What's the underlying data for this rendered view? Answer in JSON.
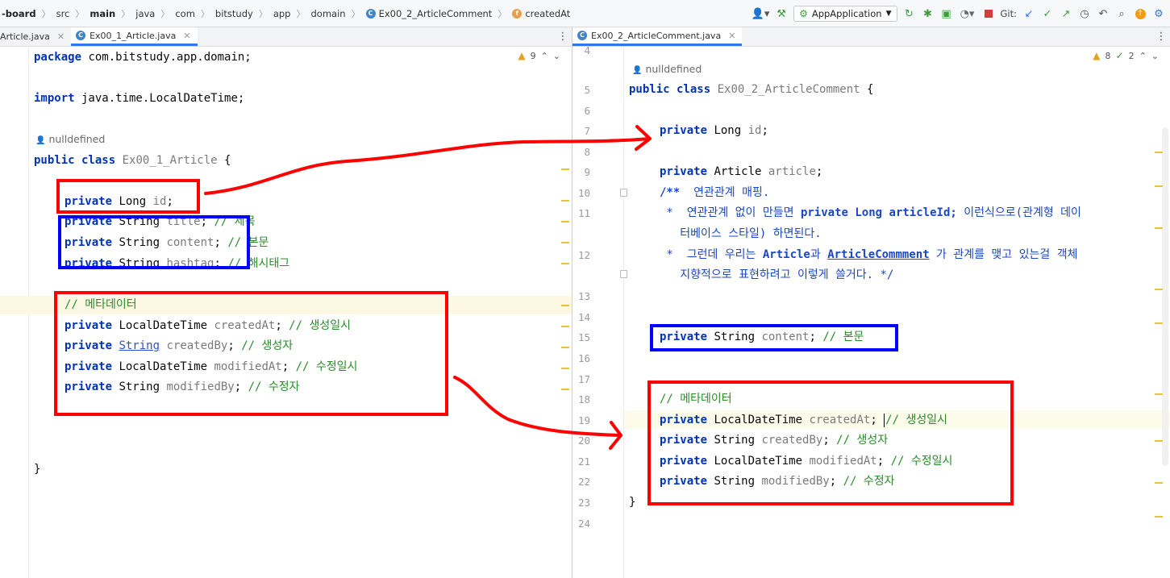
{
  "breadcrumb": {
    "items": [
      "-board",
      "src",
      "main",
      "java",
      "com",
      "bitstudy",
      "app",
      "domain",
      "Ex00_2_ArticleComment",
      "createdAt"
    ]
  },
  "toolbar": {
    "run_config": "AppApplication",
    "git_label": "Git:"
  },
  "tabs": {
    "left": [
      {
        "label": "Article.java",
        "active": false
      },
      {
        "label": "Ex00_1_Article.java",
        "active": true
      }
    ],
    "right": [
      {
        "label": "Ex00_2_ArticleComment.java",
        "active": true
      }
    ]
  },
  "left_editor": {
    "inspections": {
      "warnings": "9"
    },
    "author": "nulldefined",
    "lines": {
      "package": {
        "kw": "package",
        "rest": " com.bitstudy.app.domain;"
      },
      "import": {
        "kw": "import",
        "rest": " java.time.LocalDateTime;"
      },
      "class_decl": {
        "kw": "public class",
        "name": " Ex00_1_Article",
        "rest": " {"
      },
      "id": {
        "kw": "private",
        "type": " Long ",
        "field": "id",
        "rest": ";"
      },
      "title": {
        "kw": "private",
        "type": " String ",
        "field": "title",
        "rest": "; ",
        "comment": "// 제목"
      },
      "content": {
        "kw": "private",
        "type": " String ",
        "field": "content",
        "rest": "; ",
        "comment": "// 본문"
      },
      "hashtag": {
        "kw": "private",
        "type": " String ",
        "field": "hashtag",
        "rest": "; ",
        "comment": "// 해시태그"
      },
      "meta_comment": "// 메타데이터",
      "createdAt": {
        "kw": "private",
        "type": " LocalDateTime ",
        "field": "createdAt",
        "rest": "; ",
        "comment": "// 생성일시"
      },
      "createdBy": {
        "kw": "private",
        "type_link": "String",
        "field": " createdBy",
        "rest": "; ",
        "comment": "// 생성자"
      },
      "modifiedAt": {
        "kw": "private",
        "type": " LocalDateTime ",
        "field": "modifiedAt",
        "rest": "; ",
        "comment": "// 수정일시"
      },
      "modifiedBy": {
        "kw": "private",
        "type": " String ",
        "field": "modifiedBy",
        "rest": "; ",
        "comment": "// 수정자"
      },
      "close_brace": "}"
    }
  },
  "right_editor": {
    "inspections": {
      "warnings": "8",
      "checks": "2"
    },
    "author": "nulldefined",
    "line_numbers": [
      "4",
      "5",
      "6",
      "7",
      "8",
      "9",
      "10",
      "11",
      "12",
      "13",
      "14",
      "15",
      "16",
      "17",
      "18",
      "19",
      "20",
      "21",
      "22",
      "23",
      "24"
    ],
    "lines": {
      "class_decl": {
        "kw": "public class",
        "name": " Ex00_2_ArticleComment",
        "rest": " {"
      },
      "id": {
        "kw": "private",
        "type": " Long ",
        "field": "id",
        "rest": ";"
      },
      "article": {
        "kw": "private",
        "type": " Article ",
        "field": "article",
        "rest": ";"
      },
      "doc1": {
        "open": "/**",
        "text": "  연관관계 매핑."
      },
      "doc2": {
        "star": " *",
        "text_a": "  연관관계 없이 만들면 ",
        "code": "private Long articleId;",
        "text_b": " 이런식으로(관계형 데이"
      },
      "doc3": "   터베이스 스타일) 하면된다.",
      "doc4": {
        "star": " *",
        "text_a": "  그런데 우리는 ",
        "code_a": "Article",
        "text_b": "과 ",
        "code_b": "ArticleCommment",
        "text_c": " 가 관계를 맺고 있는걸 객체"
      },
      "doc5": "   지향적으로 표현하려고 이렇게 쓸거다. */",
      "content": {
        "kw": "private",
        "type": " String ",
        "field": "content",
        "rest": "; ",
        "comment": "// 본문"
      },
      "meta_comment": "// 메타데이터",
      "createdAt": {
        "kw": "private",
        "type": " LocalDateTime ",
        "field": "createdAt",
        "rest": "; ",
        "comment": "// 생성일시"
      },
      "createdBy": {
        "kw": "private",
        "type": " String ",
        "field": "createdBy",
        "rest": "; ",
        "comment": "// 생성자"
      },
      "modifiedAt": {
        "kw": "private",
        "type": " LocalDateTime ",
        "field": "modifiedAt",
        "rest": "; ",
        "comment": "// 수정일시"
      },
      "modifiedBy": {
        "kw": "private",
        "type": " String ",
        "field": "modifiedBy",
        "rest": "; ",
        "comment": "// 수정자"
      },
      "close_brace": "}"
    }
  },
  "annotation_colors": {
    "red": "#ff0000",
    "blue": "#0000ff"
  }
}
